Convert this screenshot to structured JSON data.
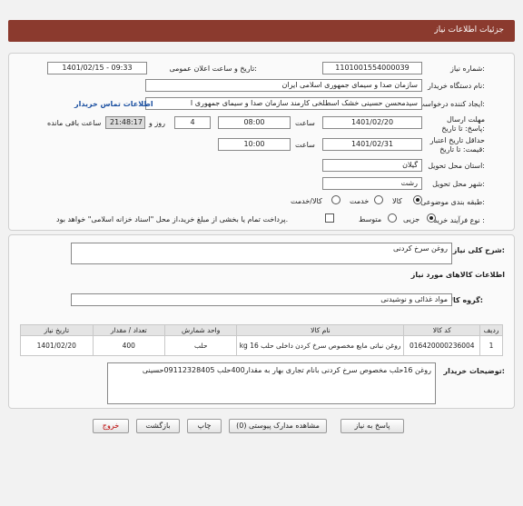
{
  "header": {
    "title": "جزئیات اطلاعات نیاز"
  },
  "form": {
    "need_number": {
      "label": "شماره نیاز:",
      "value": "1101001554000039"
    },
    "announce_datetime": {
      "label": "تاریخ و ساعت اعلان عمومی:",
      "value": "1401/02/15 - 09:33"
    },
    "buyer_org": {
      "label": "نام دستگاه خریدار:",
      "value": "سازمان صدا و سیمای جمهوری اسلامی ایران"
    },
    "requester": {
      "label": "ایجاد کننده درخواست:",
      "value": "سیدمحسن حسینی خشک اسطلخی کارمند سازمان صدا و سیمای جمهوری ا",
      "link": "اطلاعات تماس خریدار"
    },
    "deadline": {
      "label": "مهلت ارسال پاسخ: تا تاریخ:",
      "date": "1401/02/20",
      "time_label": "ساعت",
      "time": "08:00",
      "days": "4",
      "days_label": "روز و",
      "remaining": "21:48:17",
      "remaining_label": "ساعت باقی مانده"
    },
    "price_validity": {
      "label": "حداقل تاریخ اعتبار قیمت: تا تاریخ:",
      "date": "1401/02/31",
      "time_label": "ساعت",
      "time": "10:00"
    },
    "province": {
      "label": "استان محل تحویل:",
      "value": "گیلان"
    },
    "city": {
      "label": "شهر محل تحویل:",
      "value": "رشت"
    },
    "category": {
      "label": "طبقه بندی موضوعی:",
      "options": [
        "کالا",
        "خدمت",
        "کالا/خدمت"
      ],
      "selected": "کالا"
    },
    "process": {
      "label": "نوع فرآیند خرید :",
      "options": [
        "جزیی",
        "متوسط"
      ],
      "selected": "جزیی",
      "note": "پرداخت تمام یا بخشی از مبلغ خرید،از محل \"اسناد خزانه اسلامی\" خواهد بود."
    }
  },
  "general": {
    "label": "شرح کلی نیاز:",
    "value": "روغن سرخ کردنی"
  },
  "goods_info_title": "اطلاعات کالاهای مورد نیاز",
  "goods_group": {
    "label": "گروه کالا:",
    "value": "مواد غذائی و نوشیدنی"
  },
  "table": {
    "headers": [
      "ردیف",
      "کد کالا",
      "نام کالا",
      "واحد شمارش",
      "تعداد / مقدار",
      "تاریخ نیاز"
    ],
    "rows": [
      [
        "1",
        "016420000236004",
        "روغن نباتی مایع مخصوص سرخ کردن داخلی حلب 16 kg قو",
        "حلب",
        "400",
        "1401/02/20"
      ]
    ]
  },
  "buyer_notes": {
    "label": "توضیحات خریدار:",
    "value": "روغن 16حلب مخصوص سرخ کردنی بانام تجاری بهار به مقدار400حلب 09112328405حسینی"
  },
  "buttons": {
    "reply": "پاسخ به نیاز",
    "attachments": "مشاهده مدارک پیوستی (0)",
    "print": "چاپ",
    "back": "بازگشت",
    "exit": "خروج"
  },
  "watermark": {
    "brand": "ParsNamadData",
    "tagline": "مرکز فراوری اطلاعات پارس نماد داده"
  },
  "colors": {
    "header_bg": "#8b3a2e",
    "link": "#1a4fa0",
    "exit_text": "#bb0000"
  }
}
